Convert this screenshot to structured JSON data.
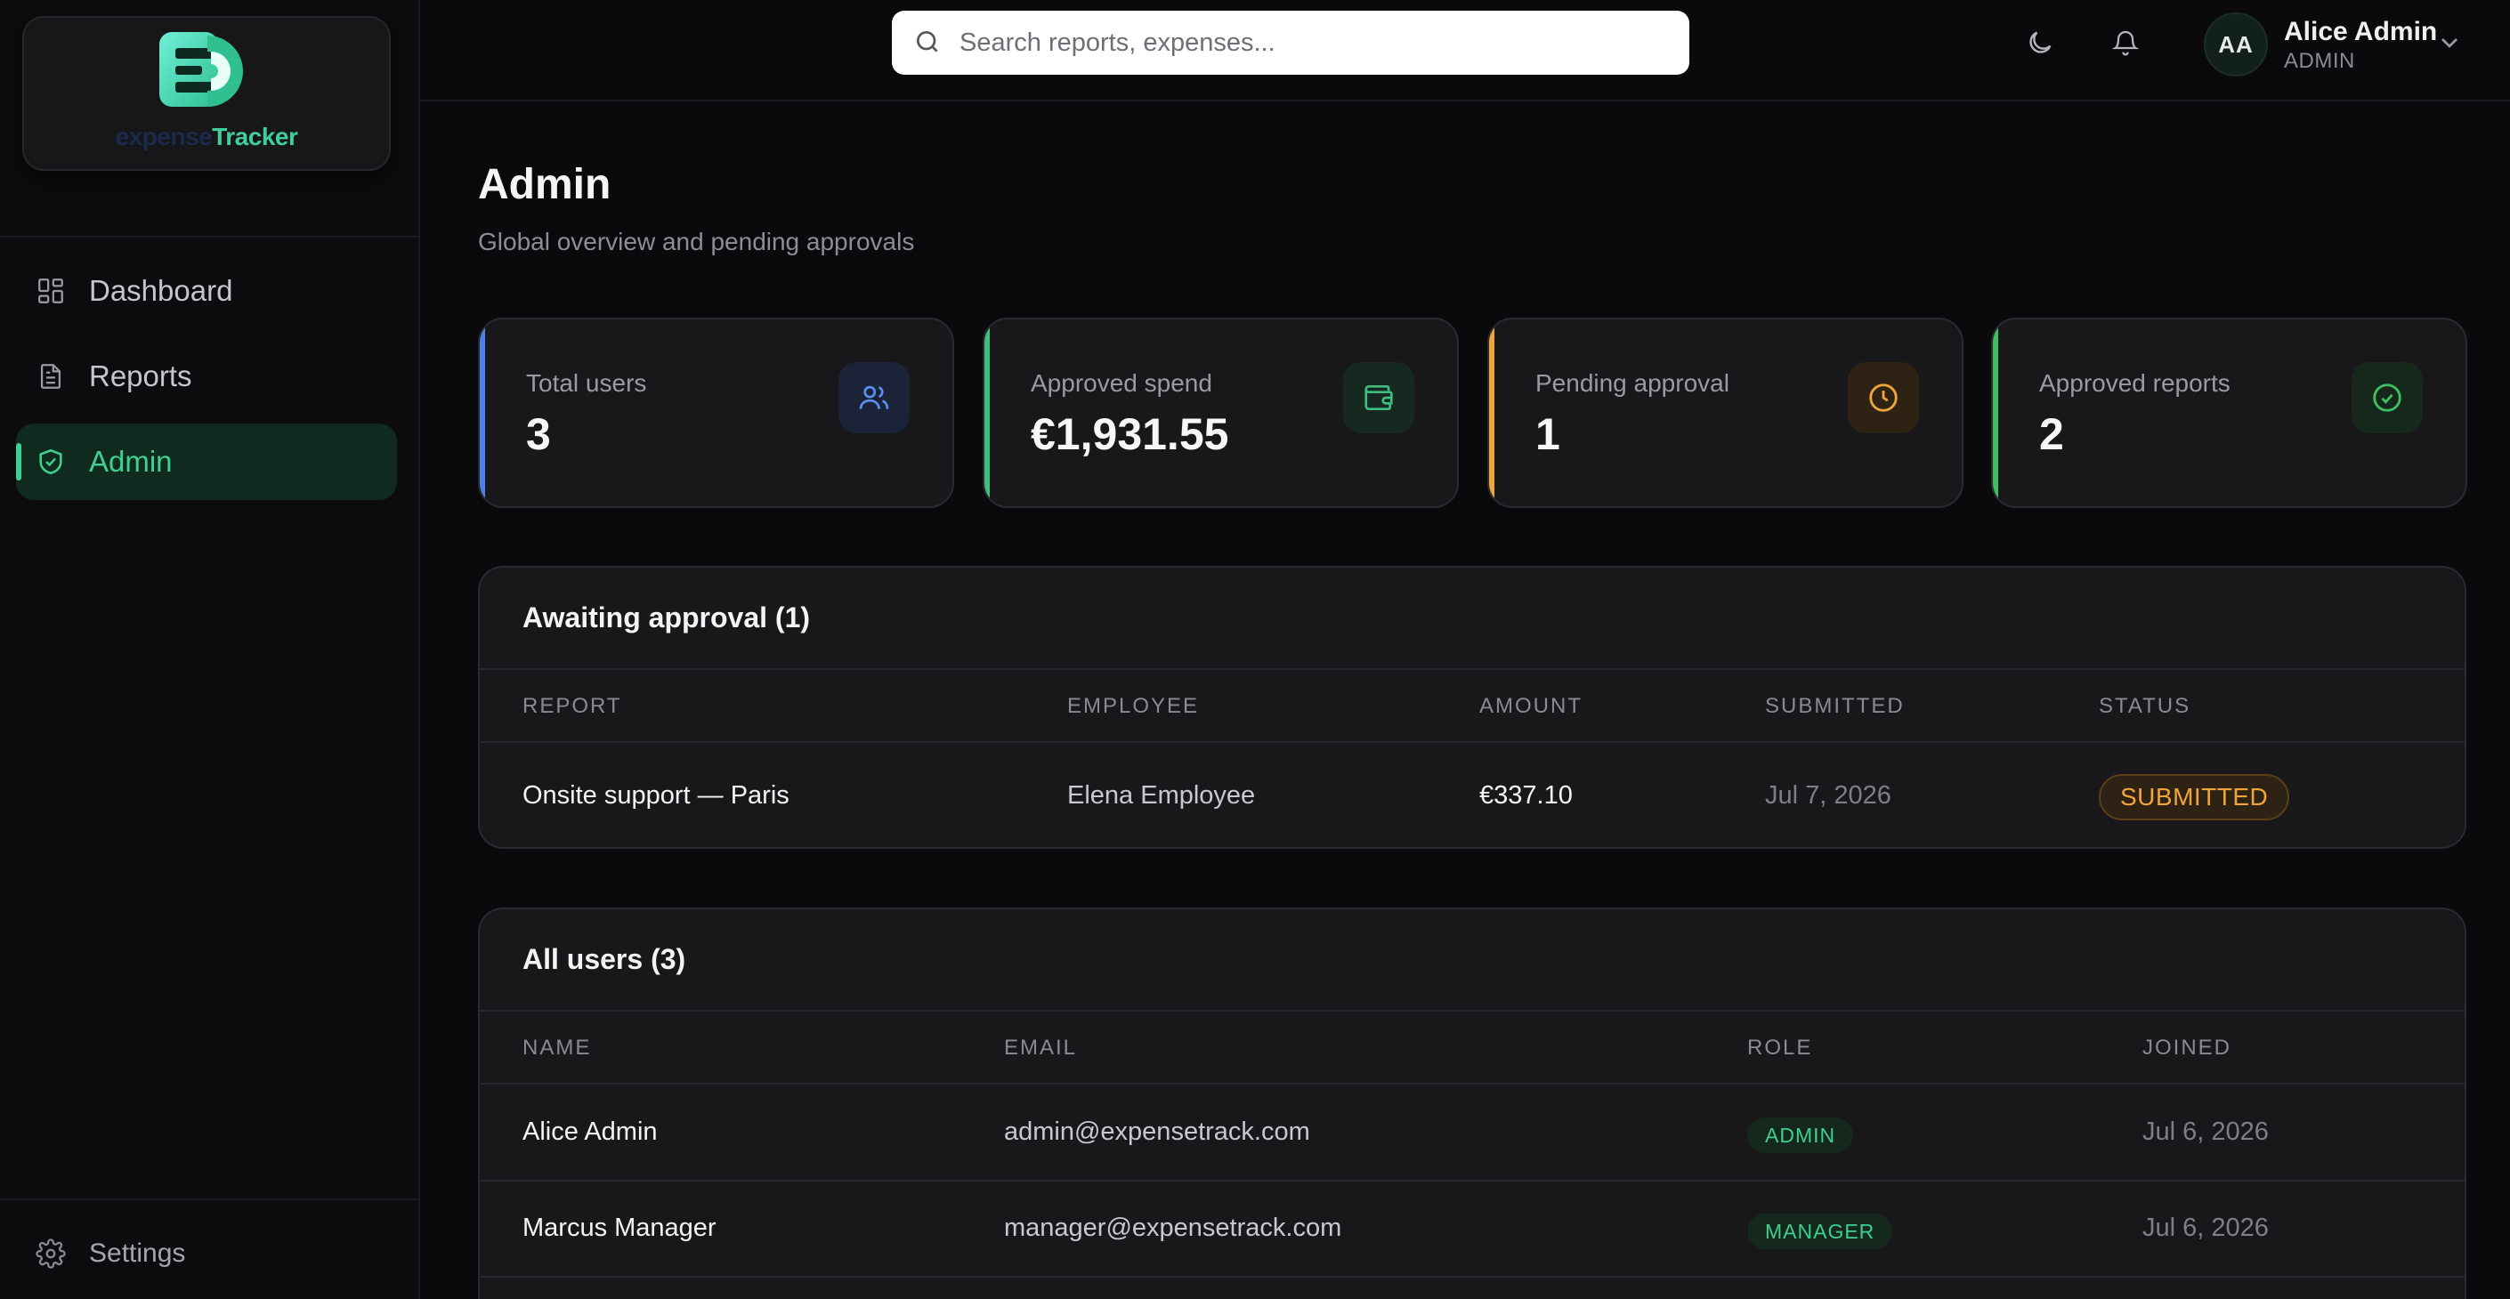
{
  "app": {
    "logo_word_a": "expense",
    "logo_word_b": "Tracker"
  },
  "sidebar": {
    "items": [
      {
        "label": "Dashboard",
        "icon": "grid-icon"
      },
      {
        "label": "Reports",
        "icon": "document-icon"
      },
      {
        "label": "Admin",
        "icon": "shield-check-icon",
        "active": true
      }
    ],
    "settings_label": "Settings"
  },
  "topbar": {
    "search_placeholder": "Search reports, expenses...",
    "user": {
      "initials": "AA",
      "name": "Alice Admin",
      "role": "ADMIN"
    }
  },
  "page": {
    "title": "Admin",
    "subtitle": "Global overview and pending approvals"
  },
  "stats": [
    {
      "label": "Total users",
      "value": "3",
      "icon": "users-icon",
      "accent": "#4f7fe8"
    },
    {
      "label": "Approved spend",
      "value": "€1,931.55",
      "icon": "wallet-icon",
      "accent": "#3fbf7f"
    },
    {
      "label": "Pending approval",
      "value": "1",
      "icon": "clock-icon",
      "accent": "#f0a53a"
    },
    {
      "label": "Approved reports",
      "value": "2",
      "icon": "check-circle-icon",
      "accent": "#3fbf5f"
    }
  ],
  "approvals": {
    "title": "Awaiting approval (1)",
    "columns": [
      "REPORT",
      "EMPLOYEE",
      "AMOUNT",
      "SUBMITTED",
      "STATUS"
    ],
    "rows": [
      {
        "report": "Onsite support — Paris",
        "employee": "Elena Employee",
        "amount": "€337.10",
        "submitted": "Jul 7, 2026",
        "status": "SUBMITTED"
      }
    ]
  },
  "users": {
    "title": "All users (3)",
    "columns": [
      "NAME",
      "EMAIL",
      "ROLE",
      "JOINED"
    ],
    "rows": [
      {
        "name": "Alice Admin",
        "email": "admin@expensetrack.com",
        "role": "ADMIN",
        "joined": "Jul 6, 2026"
      },
      {
        "name": "Marcus Manager",
        "email": "manager@expensetrack.com",
        "role": "MANAGER",
        "joined": "Jul 6, 2026"
      }
    ]
  },
  "colors": {
    "accent_green": "#3fcf8e",
    "status_submitted": "#f0a53a",
    "background": "#0a0a0c"
  }
}
